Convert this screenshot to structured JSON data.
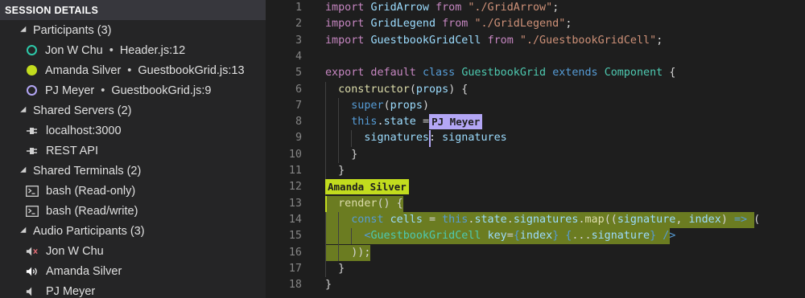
{
  "sidebar": {
    "title": "SESSION DETAILS",
    "participants": {
      "label": "Participants (3)",
      "items": [
        {
          "name": "Jon W Chu",
          "sep": "•",
          "location": "Header.js:12",
          "color": "#2dc9a9",
          "hollow": true
        },
        {
          "name": "Amanda Silver",
          "sep": "•",
          "location": "GuestbookGrid.js:13",
          "color": "#c2dc1e",
          "hollow": false
        },
        {
          "name": "PJ Meyer",
          "sep": "•",
          "location": "GuestbookGrid.js:9",
          "color": "#b3a6f5",
          "hollow": true
        }
      ]
    },
    "servers": {
      "label": "Shared Servers (2)",
      "items": [
        {
          "label": "localhost:3000",
          "icon": "plug-icon"
        },
        {
          "label": "REST API",
          "icon": "plug-icon"
        }
      ]
    },
    "terminals": {
      "label": "Shared Terminals (2)",
      "items": [
        {
          "label": "bash (Read-only)",
          "icon": "terminal-icon"
        },
        {
          "label": "bash (Read/write)",
          "icon": "terminal-icon"
        }
      ]
    },
    "audio": {
      "label": "Audio Participants (3)",
      "items": [
        {
          "label": "Jon W Chu",
          "icon": "speaker-muted-icon"
        },
        {
          "label": "Amanda Silver",
          "icon": "speaker-on-icon"
        },
        {
          "label": "PJ Meyer",
          "icon": "speaker-icon"
        }
      ]
    }
  },
  "editor": {
    "line_numbers": [
      "1",
      "2",
      "3",
      "4",
      "5",
      "6",
      "7",
      "8",
      "9",
      "10",
      "11",
      "12",
      "13",
      "14",
      "15",
      "16",
      "17",
      "18"
    ],
    "lines": [
      [
        [
          "kw",
          "import "
        ],
        [
          "var",
          "GridArrow "
        ],
        [
          "kw",
          "from "
        ],
        [
          "str",
          "\"./GridArrow\""
        ],
        [
          "pn",
          ";"
        ]
      ],
      [
        [
          "kw",
          "import "
        ],
        [
          "var",
          "GridLegend "
        ],
        [
          "kw",
          "from "
        ],
        [
          "str",
          "\"./GridLegend\""
        ],
        [
          "pn",
          ";"
        ]
      ],
      [
        [
          "kw",
          "import "
        ],
        [
          "var",
          "GuestbookGridCell "
        ],
        [
          "kw",
          "from "
        ],
        [
          "str",
          "\"./GuestbookGridCell\""
        ],
        [
          "pn",
          ";"
        ]
      ],
      [],
      [
        [
          "kw",
          "export default "
        ],
        [
          "kb",
          "class "
        ],
        [
          "cls",
          "GuestbookGrid "
        ],
        [
          "kb",
          "extends "
        ],
        [
          "cls",
          "Component "
        ],
        [
          "pn",
          "{"
        ]
      ],
      [
        [
          "pn",
          "  "
        ],
        [
          "fn",
          "constructor"
        ],
        [
          "pn",
          "("
        ],
        [
          "var",
          "props"
        ],
        [
          "pn",
          ") {"
        ]
      ],
      [
        [
          "pn",
          "    "
        ],
        [
          "kb",
          "super"
        ],
        [
          "pn",
          "("
        ],
        [
          "var",
          "props"
        ],
        [
          "pn",
          ")"
        ]
      ],
      [
        [
          "pn",
          "    "
        ],
        [
          "kb",
          "this"
        ],
        [
          "pn",
          "."
        ],
        [
          "var",
          "state "
        ],
        [
          "pn",
          "= {"
        ]
      ],
      [
        [
          "pn",
          "      "
        ],
        [
          "var",
          "signatures"
        ],
        [
          "pn",
          ": "
        ],
        [
          "var",
          "signatures"
        ]
      ],
      [
        [
          "pn",
          "    }"
        ]
      ],
      [
        [
          "pn",
          "  }"
        ]
      ],
      [],
      [
        [
          "pn",
          "  "
        ],
        [
          "fn",
          "render"
        ],
        [
          "pn",
          "() {"
        ]
      ],
      [
        [
          "pn",
          "    "
        ],
        [
          "kb",
          "const "
        ],
        [
          "var",
          "cells "
        ],
        [
          "pn",
          "= "
        ],
        [
          "kb",
          "this"
        ],
        [
          "pn",
          "."
        ],
        [
          "var",
          "state"
        ],
        [
          "pn",
          "."
        ],
        [
          "var",
          "signatures"
        ],
        [
          "pn",
          "."
        ],
        [
          "fn",
          "map"
        ],
        [
          "pn",
          "(("
        ],
        [
          "var",
          "signature"
        ],
        [
          "pn",
          ", "
        ],
        [
          "var",
          "index"
        ],
        [
          "pn",
          ") "
        ],
        [
          "kb",
          "=> "
        ],
        [
          "pn",
          "("
        ]
      ],
      [
        [
          "pn",
          "      "
        ],
        [
          "tag",
          "<"
        ],
        [
          "cls",
          "GuestbookGridCell "
        ],
        [
          "var",
          "key"
        ],
        [
          "pn",
          "="
        ],
        [
          "kb",
          "{"
        ],
        [
          "var",
          "index"
        ],
        [
          "kb",
          "} {"
        ],
        [
          "pn",
          "..."
        ],
        [
          "var",
          "signature"
        ],
        [
          "kb",
          "} "
        ],
        [
          "tag",
          "/>"
        ]
      ],
      [
        [
          "pn",
          "    ));"
        ]
      ],
      [
        [
          "pn",
          "  }"
        ]
      ],
      [
        [
          "pn",
          "}"
        ]
      ]
    ],
    "cursor_labels": [
      {
        "name": "PJ Meyer",
        "bg": "#b3a6f5",
        "fg": "#1e1e1e"
      },
      {
        "name": "Amanda Silver",
        "bg": "#c2dc1e",
        "fg": "#1e1e1e"
      }
    ],
    "colors": {
      "selection": "#6b7c21"
    }
  }
}
